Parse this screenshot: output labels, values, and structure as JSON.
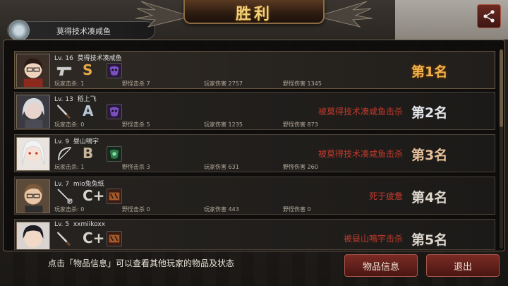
{
  "header": {
    "title": "胜利",
    "share_icon": "share-icon",
    "player_banner": "莫得技术凑咸鱼"
  },
  "players": [
    {
      "level": "Lv. 16",
      "name": "莫得技术凑咸鱼",
      "weapon_icon": "pistol-icon",
      "grade": "S",
      "item_icon": "purple-mask-icon",
      "pk_label": "玩家击杀:",
      "pk": "1",
      "mk_label": "野怪击杀",
      "mk": "7",
      "pd_label": "玩家伤害",
      "pd": "2757",
      "md_label": "野怪伤害",
      "md": "1345",
      "death": "",
      "rank": "第1名"
    },
    {
      "level": "Lv. 13",
      "name": "稻上飞",
      "weapon_icon": "knife-icon",
      "grade": "A",
      "item_icon": "purple-mask-icon",
      "pk_label": "玩家击杀:",
      "pk": "0",
      "mk_label": "野怪击杀",
      "mk": "5",
      "pd_label": "玩家伤害",
      "pd": "1235",
      "md_label": "野怪伤害",
      "md": "873",
      "death": "被莫得技术凑咸鱼击杀",
      "rank": "第2名"
    },
    {
      "level": "Lv. 9",
      "name": "昼山鳴宇",
      "weapon_icon": "bow-icon",
      "grade": "B",
      "item_icon": "green-mask-icon",
      "pk_label": "玩家击杀:",
      "pk": "1",
      "mk_label": "野怪击杀",
      "mk": "3",
      "pd_label": "玩家伤害",
      "pd": "631",
      "md_label": "野怪伤害",
      "md": "260",
      "death": "被莫得技术凑咸鱼击杀",
      "rank": "第3名"
    },
    {
      "level": "Lv. 7",
      "name": "mio兔兔纸",
      "weapon_icon": "rapier-icon",
      "grade": "C+",
      "item_icon": "box-icon",
      "pk_label": "玩家击杀:",
      "pk": "0",
      "mk_label": "野怪击杀",
      "mk": "0",
      "pd_label": "玩家伤害",
      "pd": "443",
      "md_label": "野怪伤害",
      "md": "0",
      "death": "死于疲惫",
      "rank": "第4名"
    },
    {
      "level": "Lv. 5",
      "name": "xxmiikoxx",
      "weapon_icon": "knife-icon",
      "grade": "C+",
      "item_icon": "box-icon",
      "pk_label": "",
      "pk": "",
      "mk_label": "",
      "mk": "",
      "pd_label": "",
      "pd": "",
      "md_label": "",
      "md": "",
      "death": "被昼山鳴宇击杀",
      "rank": "第5名"
    }
  ],
  "footer": {
    "hint": "点击「物品信息」可以查看其他玩家的物品及状态",
    "info_button": "物品信息",
    "exit_button": "退出"
  },
  "colors": {
    "gold": "#f2b34a",
    "death_red": "#c0392b",
    "button_red": "#7b2b24"
  }
}
